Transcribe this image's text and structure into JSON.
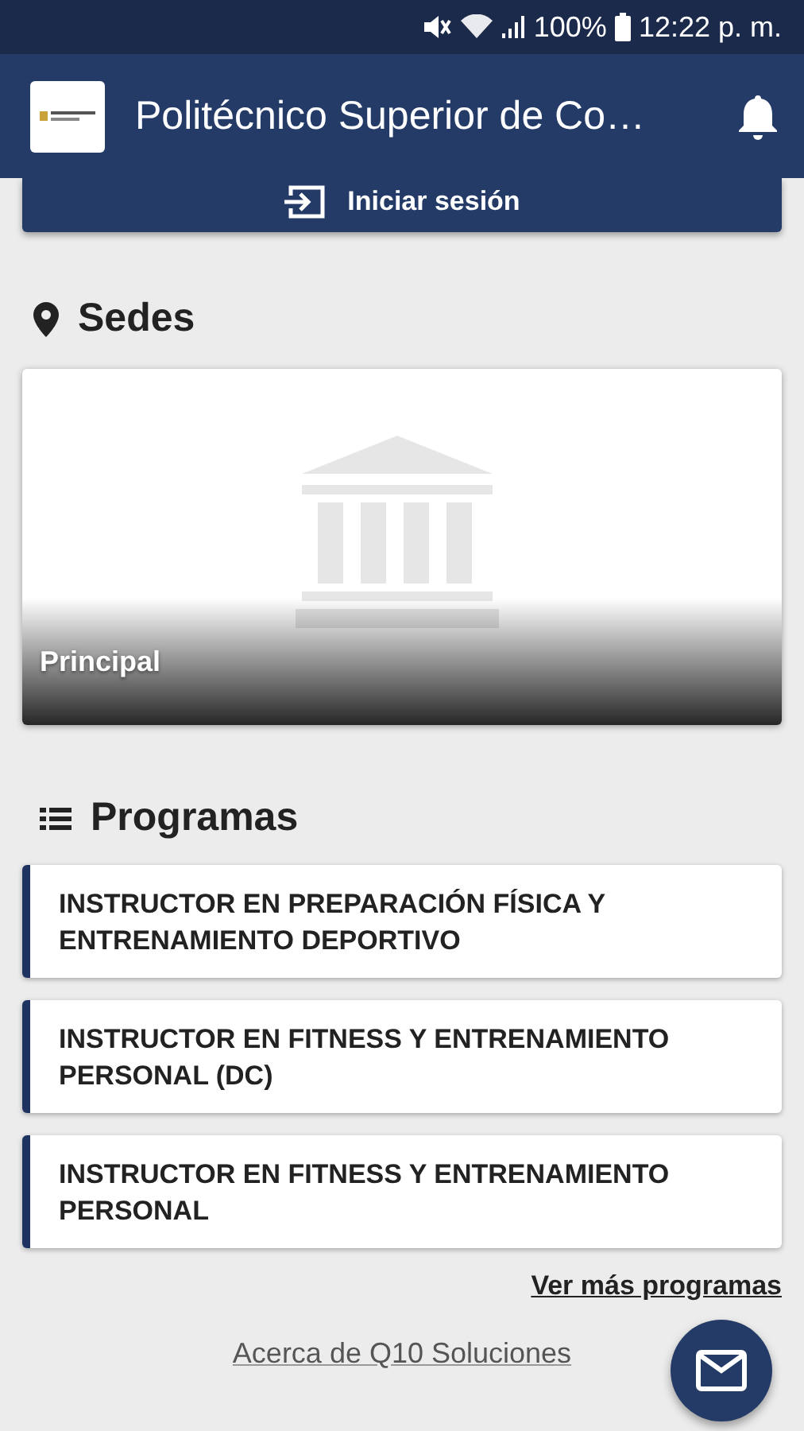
{
  "status_bar": {
    "battery": "100%",
    "time": "12:22 p. m."
  },
  "app_bar": {
    "title": "Politécnico Superior de Co…"
  },
  "login_button": {
    "label": "Iniciar sesión"
  },
  "sedes": {
    "heading": "Sedes",
    "items": [
      {
        "name": "Principal"
      }
    ]
  },
  "programas": {
    "heading": "Programas",
    "items": [
      {
        "name": "INSTRUCTOR EN PREPARACIÓN FÍSICA Y ENTRENAMIENTO DEPORTIVO"
      },
      {
        "name": "INSTRUCTOR EN FITNESS Y ENTRENAMIENTO PERSONAL (DC)"
      },
      {
        "name": "INSTRUCTOR EN FITNESS Y ENTRENAMIENTO PERSONAL"
      }
    ],
    "more_link": "Ver más programas"
  },
  "footer_link": "Acerca de Q10 Soluciones"
}
